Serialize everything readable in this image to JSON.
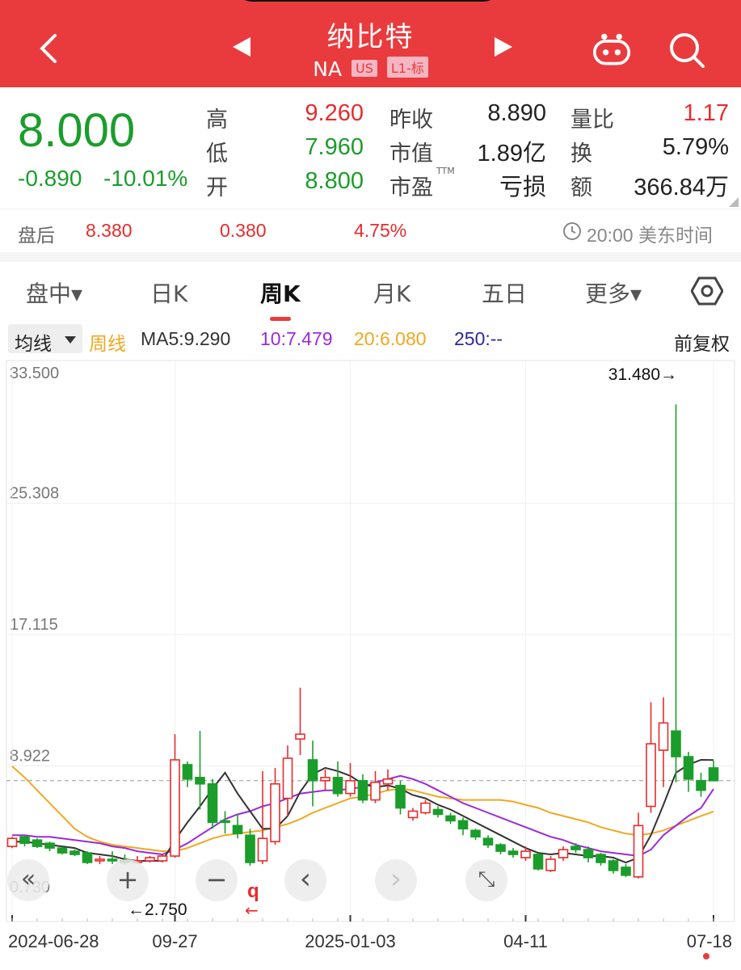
{
  "header": {
    "title": "纳比特",
    "ticker": "NA",
    "market_tag": "US",
    "level_tag": "L1-标"
  },
  "quote": {
    "price": "8.000",
    "change": "-0.890",
    "change_pct": "-10.01%",
    "labels": {
      "high": "高",
      "low": "低",
      "open": "开",
      "prev_close": "昨收",
      "market_cap": "市值",
      "pe": "市盈",
      "vol_ratio": "量比",
      "turnover": "换",
      "amount": "额"
    },
    "pe_suffix": "TTM",
    "high": "9.260",
    "low": "7.960",
    "open": "8.800",
    "prev_close": "8.890",
    "market_cap": "1.89亿",
    "pe": "亏损",
    "vol_ratio": "1.17",
    "turnover": "5.79%",
    "amount": "366.84万"
  },
  "after_hours": {
    "label": "盘后",
    "price": "8.380",
    "change": "0.380",
    "change_pct": "4.75%",
    "time": "20:00 美东时间"
  },
  "tabs": [
    "盘中▾",
    "日K",
    "周K",
    "月K",
    "五日",
    "更多▾"
  ],
  "active_tab": "周K",
  "ma_bar": {
    "selector": "均线",
    "period": "周线",
    "ma5": "MA5:9.290",
    "ma10": "10:7.479",
    "ma20": "20:6.080",
    "ma250": "250:--",
    "adjust": "前复权"
  },
  "colors": {
    "up": "#e62c2c",
    "down": "#1b9d2b",
    "header": "#e93b3d",
    "ma5": "#333333",
    "ma10": "#9b2bd8",
    "ma20": "#f0a820",
    "ma250": "#2a2a9a"
  },
  "chart_data": {
    "type": "candlestick",
    "y_ticks": [
      "33.500",
      "25.308",
      "17.115",
      "8.922",
      "0.730"
    ],
    "x_ticks": [
      "2024-06-28",
      "09-27",
      "2025-01-03",
      "04-11",
      "07-18"
    ],
    "ylim": [
      0.73,
      33.5
    ],
    "max_label": "31.480→",
    "min_label": "←2.750",
    "reference_price": 8.0,
    "candles": [
      {
        "o": 3.9,
        "c": 4.4,
        "h": 4.5,
        "l": 3.8
      },
      {
        "o": 4.5,
        "c": 4.1,
        "h": 4.6,
        "l": 3.9
      },
      {
        "o": 4.3,
        "c": 3.9,
        "h": 4.4,
        "l": 3.8
      },
      {
        "o": 4.1,
        "c": 3.8,
        "h": 4.2,
        "l": 3.6
      },
      {
        "o": 3.8,
        "c": 3.5,
        "h": 3.9,
        "l": 3.4
      },
      {
        "o": 3.6,
        "c": 3.4,
        "h": 3.7,
        "l": 3.3
      },
      {
        "o": 3.5,
        "c": 2.9,
        "h": 3.6,
        "l": 2.8
      },
      {
        "o": 3.0,
        "c": 3.1,
        "h": 3.3,
        "l": 2.8
      },
      {
        "o": 3.1,
        "c": 3.0,
        "h": 3.6,
        "l": 2.8
      },
      {
        "o": 3.0,
        "c": 2.9,
        "h": 3.4,
        "l": 2.75
      },
      {
        "o": 2.9,
        "c": 3.0,
        "h": 3.3,
        "l": 2.8
      },
      {
        "o": 3.0,
        "c": 3.2,
        "h": 3.3,
        "l": 2.9
      },
      {
        "o": 3.0,
        "c": 3.3,
        "h": 3.4,
        "l": 2.9
      },
      {
        "o": 3.3,
        "c": 9.3,
        "h": 10.9,
        "l": 3.2
      },
      {
        "o": 9.0,
        "c": 8.1,
        "h": 9.2,
        "l": 7.6
      },
      {
        "o": 8.2,
        "c": 7.8,
        "h": 11.1,
        "l": 6.2
      },
      {
        "o": 7.8,
        "c": 5.4,
        "h": 8.1,
        "l": 5.0
      },
      {
        "o": 5.5,
        "c": 5.4,
        "h": 6.1,
        "l": 4.7
      },
      {
        "o": 5.2,
        "c": 4.7,
        "h": 5.9,
        "l": 4.4
      },
      {
        "o": 4.6,
        "c": 2.9,
        "h": 5.0,
        "l": 2.7
      },
      {
        "o": 3.0,
        "c": 4.4,
        "h": 8.6,
        "l": 2.8
      },
      {
        "o": 4.2,
        "c": 7.8,
        "h": 8.8,
        "l": 4.0
      },
      {
        "o": 6.9,
        "c": 9.4,
        "h": 10.2,
        "l": 5.8
      },
      {
        "o": 10.6,
        "c": 10.9,
        "h": 13.8,
        "l": 9.6
      },
      {
        "o": 9.3,
        "c": 8.0,
        "h": 10.5,
        "l": 6.4
      },
      {
        "o": 8.0,
        "c": 8.2,
        "h": 8.7,
        "l": 7.4
      },
      {
        "o": 8.2,
        "c": 7.2,
        "h": 9.2,
        "l": 7.0
      },
      {
        "o": 7.2,
        "c": 8.0,
        "h": 9.1,
        "l": 7.0
      },
      {
        "o": 8.0,
        "c": 6.8,
        "h": 8.4,
        "l": 6.6
      },
      {
        "o": 6.8,
        "c": 7.9,
        "h": 8.6,
        "l": 6.6
      },
      {
        "o": 7.8,
        "c": 8.1,
        "h": 8.7,
        "l": 7.4
      },
      {
        "o": 7.7,
        "c": 6.3,
        "h": 8.0,
        "l": 5.9
      },
      {
        "o": 5.7,
        "c": 6.1,
        "h": 6.3,
        "l": 5.5
      },
      {
        "o": 6.0,
        "c": 6.6,
        "h": 6.8,
        "l": 5.9
      },
      {
        "o": 6.2,
        "c": 5.9,
        "h": 6.4,
        "l": 5.7
      },
      {
        "o": 5.8,
        "c": 5.5,
        "h": 6.0,
        "l": 5.3
      },
      {
        "o": 5.5,
        "c": 5.0,
        "h": 5.7,
        "l": 4.6
      },
      {
        "o": 4.9,
        "c": 4.5,
        "h": 5.0,
        "l": 4.3
      },
      {
        "o": 4.4,
        "c": 4.0,
        "h": 4.6,
        "l": 3.8
      },
      {
        "o": 4.0,
        "c": 3.6,
        "h": 4.1,
        "l": 3.4
      },
      {
        "o": 3.6,
        "c": 3.4,
        "h": 3.8,
        "l": 3.2
      },
      {
        "o": 3.2,
        "c": 3.6,
        "h": 3.9,
        "l": 3.0
      },
      {
        "o": 3.4,
        "c": 2.5,
        "h": 3.5,
        "l": 2.4
      },
      {
        "o": 2.4,
        "c": 3.1,
        "h": 3.3,
        "l": 2.3
      },
      {
        "o": 3.2,
        "c": 3.7,
        "h": 3.9,
        "l": 3.0
      },
      {
        "o": 3.9,
        "c": 3.7,
        "h": 4.1,
        "l": 3.5
      },
      {
        "o": 3.7,
        "c": 3.2,
        "h": 3.9,
        "l": 2.9
      },
      {
        "o": 3.4,
        "c": 2.9,
        "h": 3.5,
        "l": 2.7
      },
      {
        "o": 3.0,
        "c": 2.4,
        "h": 3.1,
        "l": 2.2
      },
      {
        "o": 2.6,
        "c": 2.1,
        "h": 2.8,
        "l": 2.0
      },
      {
        "o": 2.0,
        "c": 5.2,
        "h": 6.0,
        "l": 1.9
      },
      {
        "o": 6.4,
        "c": 10.3,
        "h": 12.9,
        "l": 6.0
      },
      {
        "o": 9.9,
        "c": 11.6,
        "h": 13.2,
        "l": 7.6
      },
      {
        "o": 11.1,
        "c": 9.5,
        "h": 31.48,
        "l": 7.9
      },
      {
        "o": 9.5,
        "c": 8.1,
        "h": 9.8,
        "l": 7.3
      },
      {
        "o": 8.0,
        "c": 7.4,
        "h": 8.5,
        "l": 7.0
      },
      {
        "o": 8.8,
        "c": 8.0,
        "h": 9.26,
        "l": 7.96
      }
    ],
    "ma5": [
      4.2,
      4.2,
      4.1,
      4.0,
      3.9,
      3.8,
      3.5,
      3.4,
      3.3,
      3.1,
      3.0,
      3.0,
      3.0,
      4.3,
      5.4,
      6.4,
      7.5,
      8.5,
      7.2,
      6.1,
      5.0,
      5.0,
      5.8,
      7.3,
      8.4,
      8.8,
      8.6,
      8.3,
      7.8,
      7.6,
      7.7,
      7.5,
      7.1,
      6.9,
      6.5,
      6.2,
      5.8,
      5.4,
      5.0,
      4.6,
      4.2,
      3.8,
      3.5,
      3.4,
      3.5,
      3.4,
      3.3,
      3.3,
      3.2,
      2.9,
      3.2,
      4.6,
      6.5,
      8.5,
      9.0,
      9.3,
      9.29
    ],
    "ma10": [
      4.6,
      4.6,
      4.5,
      4.5,
      4.4,
      4.3,
      4.2,
      4.1,
      3.9,
      3.8,
      3.6,
      3.5,
      3.4,
      3.7,
      4.1,
      4.6,
      5.1,
      5.6,
      5.9,
      6.1,
      6.4,
      6.6,
      6.9,
      7.2,
      7.3,
      7.4,
      7.4,
      7.5,
      7.6,
      7.9,
      8.1,
      8.3,
      8.1,
      7.8,
      7.4,
      7.0,
      6.6,
      6.3,
      6.0,
      5.7,
      5.4,
      5.1,
      4.8,
      4.5,
      4.3,
      4.0,
      3.8,
      3.6,
      3.5,
      3.4,
      3.3,
      3.7,
      4.6,
      5.2,
      5.8,
      6.3,
      7.48
    ],
    "ma20": [
      8.9,
      8.2,
      7.4,
      6.6,
      5.8,
      5.0,
      4.5,
      4.2,
      4.0,
      3.9,
      3.8,
      3.7,
      3.6,
      3.6,
      3.8,
      4.1,
      4.4,
      4.6,
      4.7,
      4.8,
      4.9,
      5.1,
      5.3,
      5.6,
      6.0,
      6.3,
      6.6,
      6.9,
      7.0,
      7.2,
      7.4,
      7.5,
      7.4,
      7.2,
      7.0,
      6.9,
      6.8,
      6.8,
      6.8,
      6.8,
      6.7,
      6.5,
      6.3,
      6.0,
      5.8,
      5.6,
      5.4,
      5.1,
      4.9,
      4.7,
      4.6,
      4.7,
      4.9,
      5.2,
      5.5,
      5.8,
      6.08
    ]
  },
  "toolbar": {
    "collapse": "«",
    "zoom_in": "+",
    "zoom_out": "−",
    "prev": "‹",
    "next": "›",
    "fullscreen": "⤡",
    "marker": "q"
  }
}
